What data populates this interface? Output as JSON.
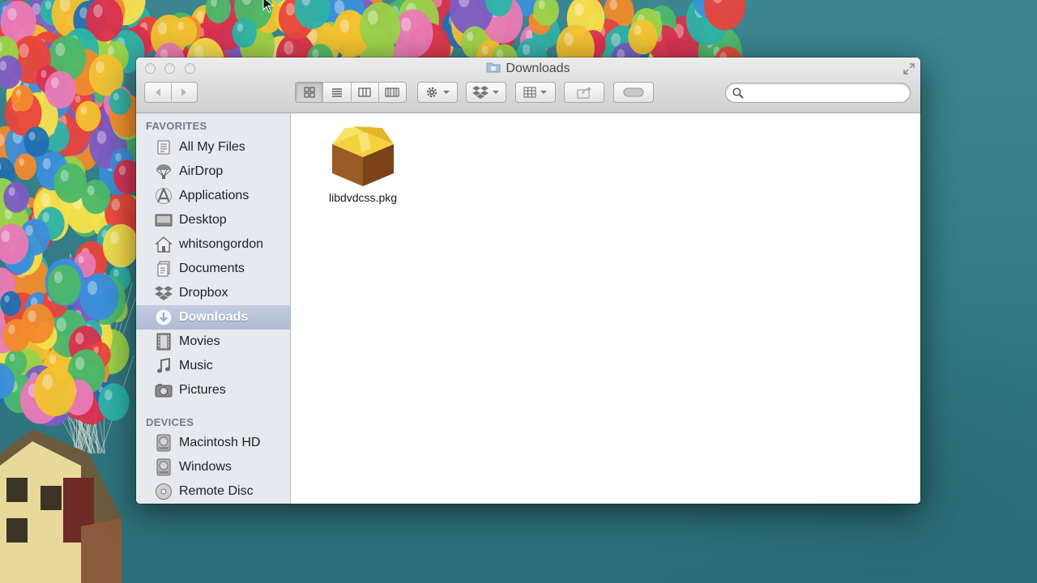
{
  "window": {
    "title": "Downloads"
  },
  "toolbar": {
    "back_icon": "chevron-left-icon",
    "forward_icon": "chevron-right-icon",
    "view_modes": [
      "icon-view",
      "list-view",
      "column-view",
      "cover-flow-view"
    ],
    "active_view": "icon-view",
    "action_icon": "gear-icon",
    "dropbox_icon": "dropbox-icon",
    "arrange_icon": "grid-icon",
    "share_icon": "share-icon",
    "tags_icon": "toggle-icon",
    "search_placeholder": ""
  },
  "sidebar": {
    "favorites_header": "FAVORITES",
    "favorites": [
      {
        "label": "All My Files",
        "icon": "all-files-icon"
      },
      {
        "label": "AirDrop",
        "icon": "airdrop-icon"
      },
      {
        "label": "Applications",
        "icon": "applications-icon"
      },
      {
        "label": "Desktop",
        "icon": "desktop-icon"
      },
      {
        "label": "whitsongordon",
        "icon": "home-icon"
      },
      {
        "label": "Documents",
        "icon": "documents-icon"
      },
      {
        "label": "Dropbox",
        "icon": "dropbox-icon"
      },
      {
        "label": "Downloads",
        "icon": "downloads-icon",
        "selected": true
      },
      {
        "label": "Movies",
        "icon": "movies-icon"
      },
      {
        "label": "Music",
        "icon": "music-icon"
      },
      {
        "label": "Pictures",
        "icon": "pictures-icon"
      }
    ],
    "devices_header": "DEVICES",
    "devices": [
      {
        "label": "Macintosh HD",
        "icon": "hard-drive-icon"
      },
      {
        "label": "Windows",
        "icon": "hard-drive-icon"
      },
      {
        "label": "Remote Disc",
        "icon": "disc-icon"
      }
    ]
  },
  "content": {
    "files": [
      {
        "name": "libdvdcss.pkg",
        "icon": "package-icon"
      }
    ]
  },
  "colors": {
    "selection": "#aebbd3",
    "sidebar_bg": "#e6eaef",
    "desktop": "#347c86"
  }
}
